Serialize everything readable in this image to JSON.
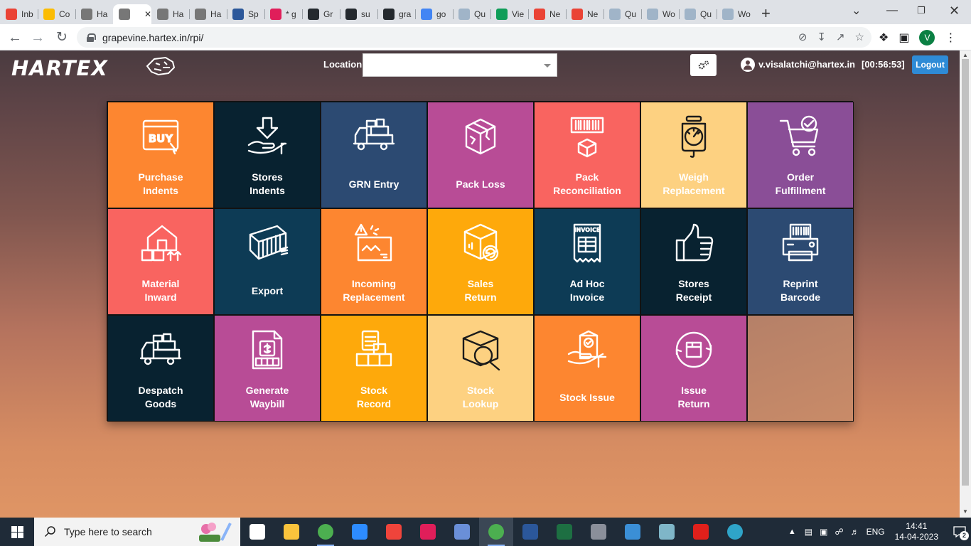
{
  "browser": {
    "tabs": [
      {
        "title": "Inb",
        "icon": "gmail-icon",
        "color": "#ea4335"
      },
      {
        "title": "Co",
        "icon": "drive-icon",
        "color": "#fbbc04"
      },
      {
        "title": "Ha",
        "icon": "hartex-tiger-icon",
        "color": "#777777"
      },
      {
        "title": "",
        "icon": "hartex-tiger-icon",
        "color": "#777777",
        "active": true
      },
      {
        "title": "Ha",
        "icon": "hartex-tiger-icon",
        "color": "#777777"
      },
      {
        "title": "Ha",
        "icon": "hartex-tiger-icon",
        "color": "#777777"
      },
      {
        "title": "Sp",
        "icon": "screen-icon",
        "color": "#2b579a"
      },
      {
        "title": "* g",
        "icon": "slack-icon",
        "color": "#e01e5a"
      },
      {
        "title": "Gr",
        "icon": "github-icon",
        "color": "#24292e"
      },
      {
        "title": "su",
        "icon": "github-icon",
        "color": "#24292e"
      },
      {
        "title": "gra",
        "icon": "github-icon",
        "color": "#24292e"
      },
      {
        "title": "go",
        "icon": "google-icon",
        "color": "#4285f4"
      },
      {
        "title": "Qu",
        "icon": "doc-icon",
        "color": "#a0b4c8"
      },
      {
        "title": "Vie",
        "icon": "sheets-icon",
        "color": "#0f9d58"
      },
      {
        "title": "Ne",
        "icon": "location-icon",
        "color": "#ea4335"
      },
      {
        "title": "Ne",
        "icon": "location-icon",
        "color": "#ea4335"
      },
      {
        "title": "Qu",
        "icon": "doc-icon",
        "color": "#a0b4c8"
      },
      {
        "title": "Wo",
        "icon": "doc-icon",
        "color": "#a0b4c8"
      },
      {
        "title": "Qu",
        "icon": "doc-icon",
        "color": "#a0b4c8"
      },
      {
        "title": "Wo",
        "icon": "doc-icon",
        "color": "#a0b4c8"
      }
    ],
    "url": "grapevine.hartex.in/rpi/",
    "profile_initial": "V",
    "new_tab": "+"
  },
  "header": {
    "logo": "HARTEX",
    "location_label": "Location",
    "location_value": "",
    "user_email": "v.visalatchi@hartex.in",
    "session_timer": "[00:56:53]",
    "logout_label": "Logout"
  },
  "tiles": [
    {
      "label": "Purchase\nIndents",
      "icon": "buy-icon",
      "bg": "#fd8630",
      "stroke": "#ffffff"
    },
    {
      "label": "Stores\nIndents",
      "icon": "hand-receive-icon",
      "bg": "#082230",
      "stroke": "#ffffff"
    },
    {
      "label": "GRN Entry",
      "icon": "truck-icon",
      "bg": "#2c4a72",
      "stroke": "#ffffff"
    },
    {
      "label": "Pack Loss",
      "icon": "broken-box-icon",
      "bg": "#b84c96",
      "stroke": "#ffffff"
    },
    {
      "label": "Pack\nReconciliation",
      "icon": "barcode-box-icon",
      "bg": "#f96460",
      "stroke": "#ffffff"
    },
    {
      "label": "Weigh\nReplacement",
      "icon": "weighing-scale-icon",
      "bg": "#fdd181",
      "stroke": "#1b1b1b"
    },
    {
      "label": "Order\nFulfillment",
      "icon": "cart-check-icon",
      "bg": "#8a4e97",
      "stroke": "#ffffff"
    },
    {
      "label": "Material\nInward",
      "icon": "warehouse-icon",
      "bg": "#f96460",
      "stroke": "#ffffff"
    },
    {
      "label": "Export",
      "icon": "container-icon",
      "bg": "#0d3b55",
      "stroke": "#ffffff"
    },
    {
      "label": "Incoming\nReplacement",
      "icon": "damaged-package-icon",
      "bg": "#fd8630",
      "stroke": "#ffffff"
    },
    {
      "label": "Sales\nReturn",
      "icon": "box-return-icon",
      "bg": "#fea90b",
      "stroke": "#ffffff"
    },
    {
      "label": "Ad Hoc\nInvoice",
      "icon": "invoice-icon",
      "bg": "#0d3b55",
      "stroke": "#ffffff"
    },
    {
      "label": "Stores\nReceipt",
      "icon": "thumbs-up-icon",
      "bg": "#082230",
      "stroke": "#ffffff"
    },
    {
      "label": "Reprint\nBarcode",
      "icon": "barcode-printer-icon",
      "bg": "#2c4a72",
      "stroke": "#ffffff"
    },
    {
      "label": "Despatch\nGoods",
      "icon": "delivery-truck-icon",
      "bg": "#082230",
      "stroke": "#ffffff"
    },
    {
      "label": "Generate\nWaybill",
      "icon": "waybill-icon",
      "bg": "#b84c96",
      "stroke": "#ffffff"
    },
    {
      "label": "Stock\nRecord",
      "icon": "stock-boxes-icon",
      "bg": "#fea90b",
      "stroke": "#ffffff"
    },
    {
      "label": "Stock\nLookup",
      "icon": "box-search-icon",
      "bg": "#fdd181",
      "stroke": "#1b1b1b"
    },
    {
      "label": "Stock Issue",
      "icon": "hand-box-icon",
      "bg": "#fd8630",
      "stroke": "#ffffff"
    },
    {
      "label": "Issue\nReturn",
      "icon": "circular-return-icon",
      "bg": "#b84c96",
      "stroke": "#ffffff"
    }
  ],
  "taskbar": {
    "search_placeholder": "Type here to search",
    "apps": [
      {
        "icon": "task-view-icon",
        "color": "#ffffff"
      },
      {
        "icon": "file-explorer-icon",
        "color": "#f9c33c"
      },
      {
        "icon": "chrome-icon",
        "color": "#4caf50"
      },
      {
        "icon": "zoom-icon",
        "color": "#2d8cff"
      },
      {
        "icon": "anydesk-icon",
        "color": "#ef443b"
      },
      {
        "icon": "slack-icon",
        "color": "#e01e5a"
      },
      {
        "icon": "remote-desktop-icon",
        "color": "#6a8fd8"
      },
      {
        "icon": "chrome-icon",
        "color": "#4caf50",
        "active": true
      },
      {
        "icon": "word-icon",
        "color": "#2b579a"
      },
      {
        "icon": "excel-icon",
        "color": "#1d6f42"
      },
      {
        "icon": "calculator-icon",
        "color": "#8a8f9a"
      },
      {
        "icon": "photos-icon",
        "color": "#3b8fd6"
      },
      {
        "icon": "snip-icon",
        "color": "#7fb6c8"
      },
      {
        "icon": "acrobat-icon",
        "color": "#e0201b"
      },
      {
        "icon": "edge-icon",
        "color": "#2fa4c8"
      }
    ],
    "language": "ENG",
    "time": "14:41",
    "date": "14-04-2023",
    "notifications": "2"
  }
}
